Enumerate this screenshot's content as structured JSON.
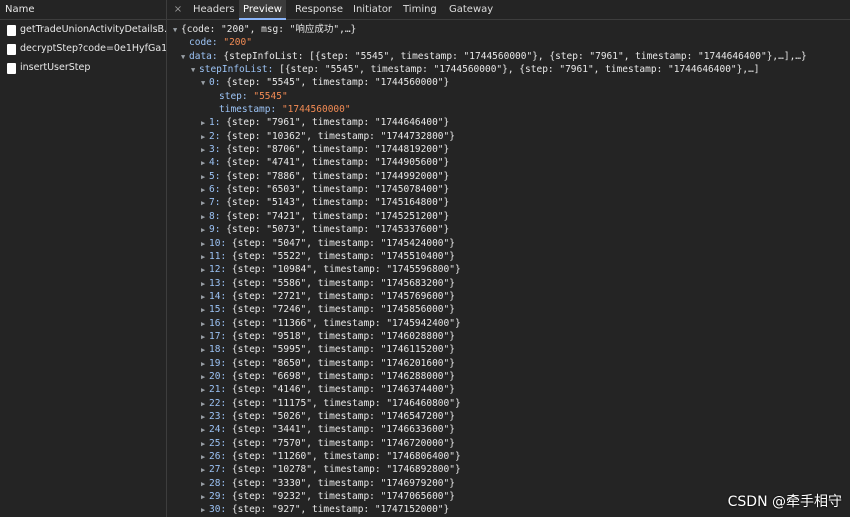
{
  "request_list": {
    "header": "Name",
    "items": [
      {
        "name": "getTradeUnionActivityDetailsB..."
      },
      {
        "name": "decryptStep?code=0e1HyfGa1..."
      },
      {
        "name": "insertUserStep"
      }
    ]
  },
  "tabs": {
    "close": "×",
    "items": [
      {
        "label": "Headers",
        "active": false
      },
      {
        "label": "Preview",
        "active": true
      },
      {
        "label": "Response",
        "active": false
      },
      {
        "label": "Initiator",
        "active": false
      },
      {
        "label": "Timing",
        "active": false
      },
      {
        "label": "Gateway",
        "active": false
      }
    ]
  },
  "preview": {
    "root_summary": "{code: \"200\", msg: \"响应成功\",…}",
    "code_key": "code:",
    "code_val": "\"200\"",
    "data_key": "data:",
    "data_summary": "{stepInfoList: [{step: \"5545\", timestamp: \"1744560000\"}, {step: \"7961\", timestamp: \"1744646400\"},…],…}",
    "list_key": "stepInfoList:",
    "list_summary": "[{step: \"5545\", timestamp: \"1744560000\"}, {step: \"7961\", timestamp: \"1744646400\"},…]",
    "item0_key": "0:",
    "item0_summary": "{step: \"5545\", timestamp: \"1744560000\"}",
    "item0_step_key": "step:",
    "item0_step_val": "\"5545\"",
    "item0_ts_key": "timestamp:",
    "item0_ts_val": "\"1744560000\"",
    "entries": [
      {
        "key": "1:",
        "summary": "{step: \"7961\", timestamp: \"1744646400\"}"
      },
      {
        "key": "2:",
        "summary": "{step: \"10362\", timestamp: \"1744732800\"}"
      },
      {
        "key": "3:",
        "summary": "{step: \"8706\", timestamp: \"1744819200\"}"
      },
      {
        "key": "4:",
        "summary": "{step: \"4741\", timestamp: \"1744905600\"}"
      },
      {
        "key": "5:",
        "summary": "{step: \"7886\", timestamp: \"1744992000\"}"
      },
      {
        "key": "6:",
        "summary": "{step: \"6503\", timestamp: \"1745078400\"}"
      },
      {
        "key": "7:",
        "summary": "{step: \"5143\", timestamp: \"1745164800\"}"
      },
      {
        "key": "8:",
        "summary": "{step: \"7421\", timestamp: \"1745251200\"}"
      },
      {
        "key": "9:",
        "summary": "{step: \"5073\", timestamp: \"1745337600\"}"
      },
      {
        "key": "10:",
        "summary": "{step: \"5047\", timestamp: \"1745424000\"}"
      },
      {
        "key": "11:",
        "summary": "{step: \"5522\", timestamp: \"1745510400\"}"
      },
      {
        "key": "12:",
        "summary": "{step: \"10984\", timestamp: \"1745596800\"}"
      },
      {
        "key": "13:",
        "summary": "{step: \"5586\", timestamp: \"1745683200\"}"
      },
      {
        "key": "14:",
        "summary": "{step: \"2721\", timestamp: \"1745769600\"}"
      },
      {
        "key": "15:",
        "summary": "{step: \"7246\", timestamp: \"1745856000\"}"
      },
      {
        "key": "16:",
        "summary": "{step: \"11366\", timestamp: \"1745942400\"}"
      },
      {
        "key": "17:",
        "summary": "{step: \"9518\", timestamp: \"1746028800\"}"
      },
      {
        "key": "18:",
        "summary": "{step: \"5995\", timestamp: \"1746115200\"}"
      },
      {
        "key": "19:",
        "summary": "{step: \"8650\", timestamp: \"1746201600\"}"
      },
      {
        "key": "20:",
        "summary": "{step: \"6698\", timestamp: \"1746288000\"}"
      },
      {
        "key": "21:",
        "summary": "{step: \"4146\", timestamp: \"1746374400\"}"
      },
      {
        "key": "22:",
        "summary": "{step: \"11175\", timestamp: \"1746460800\"}"
      },
      {
        "key": "23:",
        "summary": "{step: \"5026\", timestamp: \"1746547200\"}"
      },
      {
        "key": "24:",
        "summary": "{step: \"3441\", timestamp: \"1746633600\"}"
      },
      {
        "key": "25:",
        "summary": "{step: \"7570\", timestamp: \"1746720000\"}"
      },
      {
        "key": "26:",
        "summary": "{step: \"11260\", timestamp: \"1746806400\"}"
      },
      {
        "key": "27:",
        "summary": "{step: \"10278\", timestamp: \"1746892800\"}"
      },
      {
        "key": "28:",
        "summary": "{step: \"3330\", timestamp: \"1746979200\"}"
      },
      {
        "key": "29:",
        "summary": "{step: \"9232\", timestamp: \"1747065600\"}"
      },
      {
        "key": "30:",
        "summary": "{step: \"927\", timestamp: \"1747152000\"}"
      }
    ]
  },
  "watermark": "CSDN @牵手相守"
}
